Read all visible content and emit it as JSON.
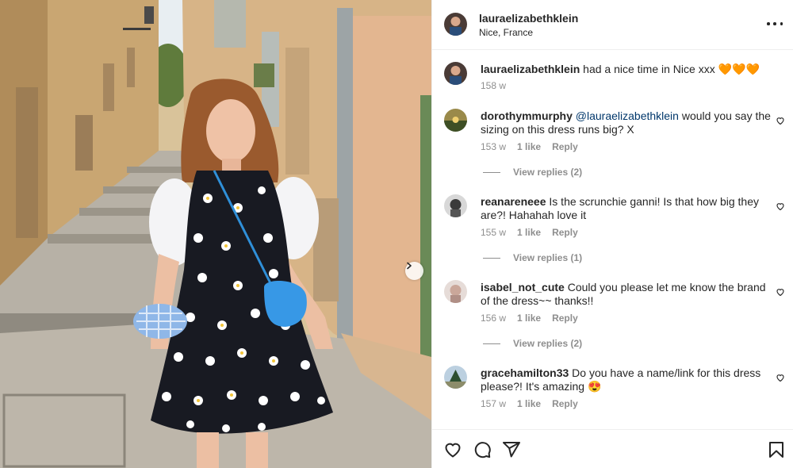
{
  "post": {
    "username": "lauraelizabethklein",
    "location": "Nice, France",
    "more_icon": "more-horizontal-icon",
    "carousel_next_icon": "chevron-right-icon"
  },
  "caption": {
    "author": "lauraelizabethklein",
    "text": " had a nice time in Nice xxx 🧡🧡🧡",
    "time": "158 w"
  },
  "comments": [
    {
      "author": "dorothymmurphy",
      "mention": "@lauraelizabethklein",
      "text": " would you say the sizing on this dress runs big? X",
      "time": "153 w",
      "likes": "1 like",
      "reply": "Reply",
      "view_replies": "View replies (2)"
    },
    {
      "author": "reanareneee",
      "mention": "",
      "text": " Is the scrunchie ganni! Is that how big they are?! Hahahah love it",
      "time": "155 w",
      "likes": "1 like",
      "reply": "Reply",
      "view_replies": "View replies (1)"
    },
    {
      "author": "isabel_not_cute",
      "mention": "",
      "text": " Could you please let me know the brand of the dress~~ thanks!!",
      "time": "156 w",
      "likes": "1 like",
      "reply": "Reply",
      "view_replies": "View replies (2)"
    },
    {
      "author": "gracehamilton33",
      "mention": "",
      "text": " Do you have a name/link for this dress please?! It's amazing 😍",
      "time": "157 w",
      "likes": "1 like",
      "reply": "Reply",
      "view_replies": ""
    }
  ],
  "actions": {
    "like_icon": "heart-icon",
    "comment_icon": "comment-icon",
    "share_icon": "paper-plane-icon",
    "save_icon": "bookmark-icon"
  },
  "colors": {
    "text": "#262626",
    "secondary": "#8e8e8e",
    "mention": "#00376b",
    "divider": "#efefef"
  }
}
